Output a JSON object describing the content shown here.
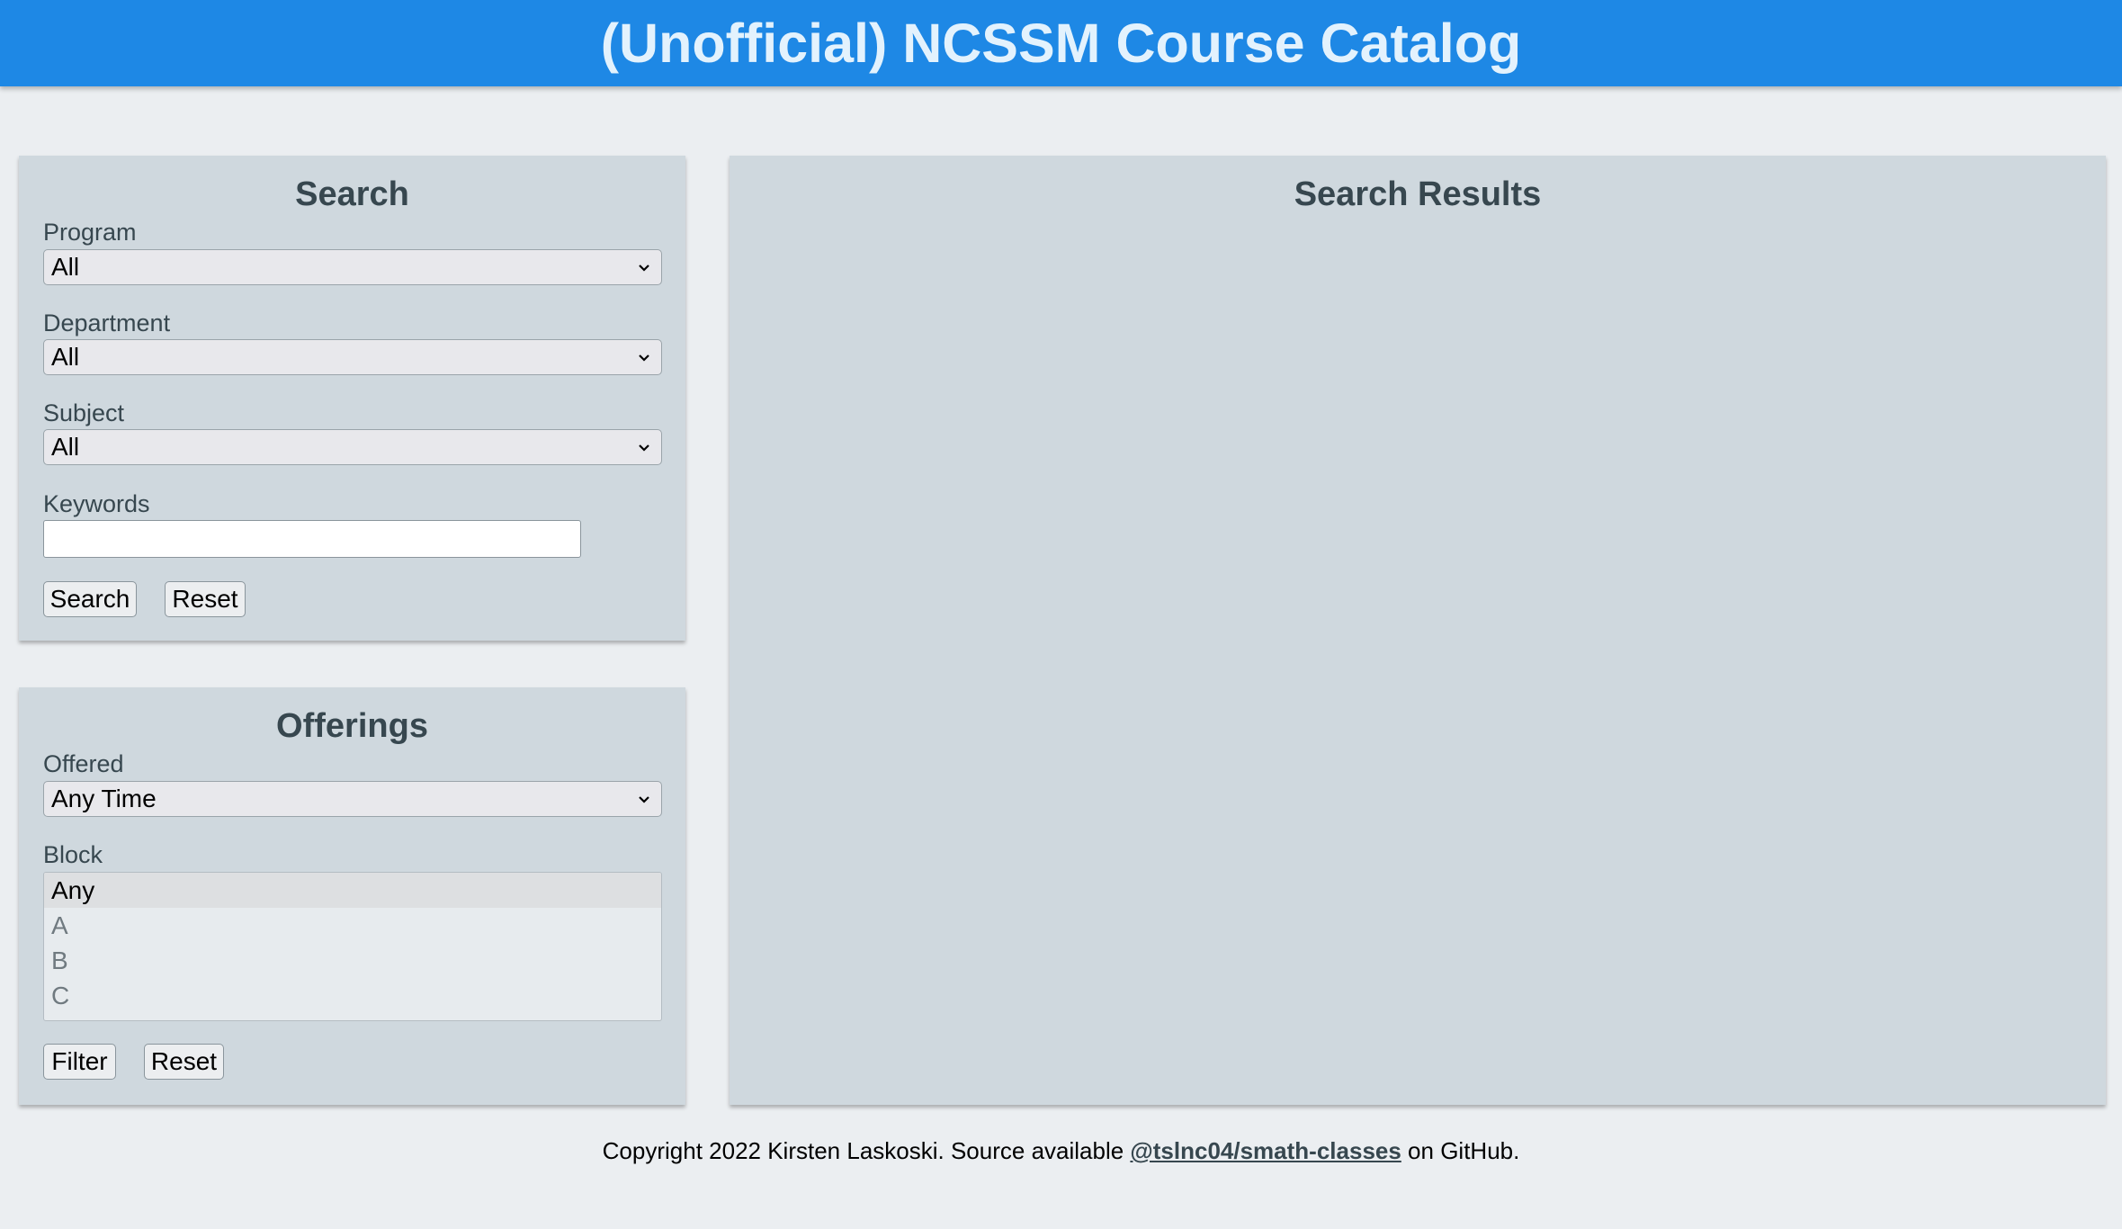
{
  "header": {
    "title": "(Unofficial) NCSSM Course Catalog"
  },
  "search": {
    "heading": "Search",
    "program": {
      "label": "Program",
      "value": "All"
    },
    "department": {
      "label": "Department",
      "value": "All"
    },
    "subject": {
      "label": "Subject",
      "value": "All"
    },
    "keywords": {
      "label": "Keywords",
      "value": "",
      "placeholder": ""
    },
    "search_button": "Search",
    "reset_button": "Reset"
  },
  "offerings": {
    "heading": "Offerings",
    "offered": {
      "label": "Offered",
      "value": "Any Time"
    },
    "block": {
      "label": "Block",
      "options": [
        "Any",
        "A",
        "B",
        "C"
      ],
      "selected": "Any"
    },
    "filter_button": "Filter",
    "reset_button": "Reset"
  },
  "results": {
    "heading": "Search Results"
  },
  "footer": {
    "text_before": "Copyright 2022 Kirsten Laskoski. Source available ",
    "link_text": "@tslnc04/smath-classes",
    "text_after": " on GitHub."
  },
  "colors": {
    "header_bg": "#1e88e5",
    "header_text": "#e3f2fd",
    "panel_bg": "#cfd8de",
    "page_bg": "#ebeef1",
    "heading_text": "#37474f"
  },
  "icons": {
    "select_arrow": "chevron-down-icon"
  }
}
